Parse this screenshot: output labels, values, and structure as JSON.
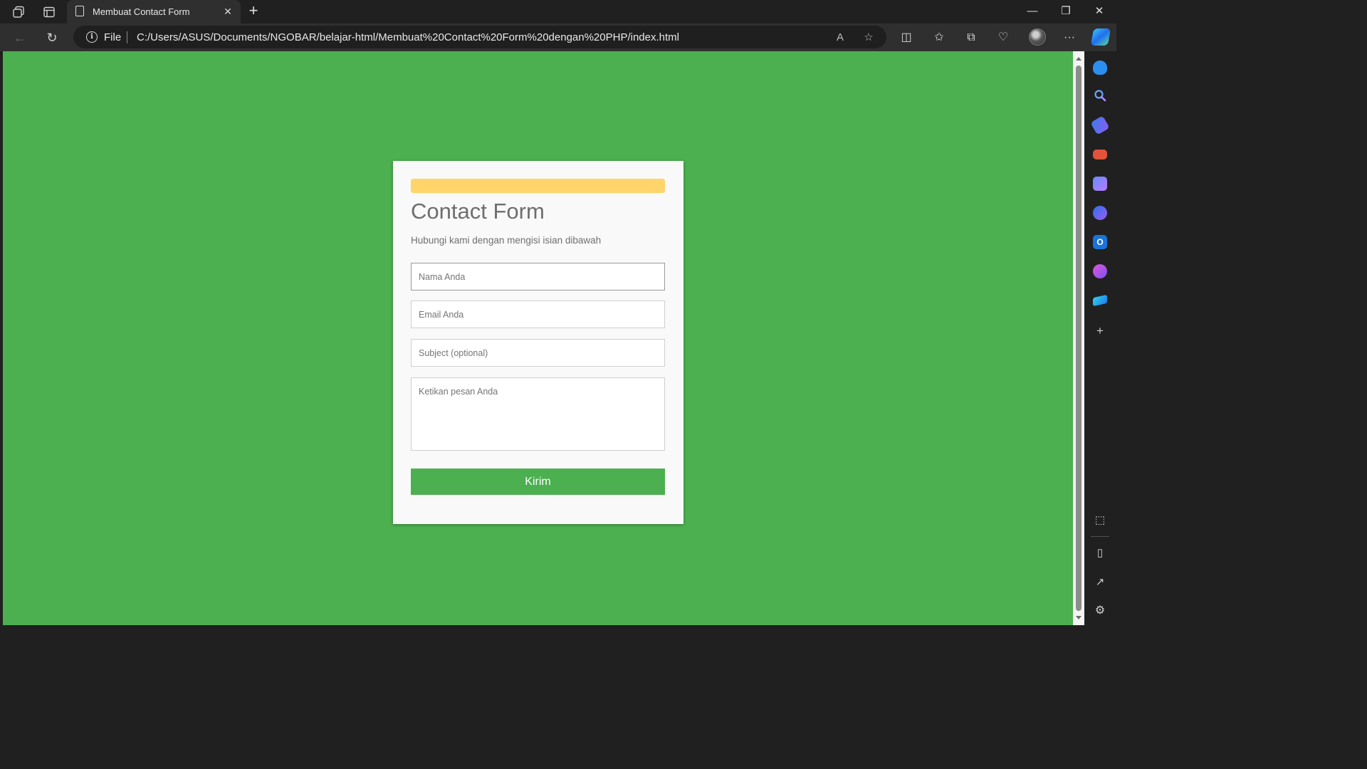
{
  "browser": {
    "tab_title": "Membuat Contact Form",
    "tab_close": "✕",
    "new_tab": "+",
    "window_controls": {
      "minimize": "—",
      "restore": "❐",
      "close": "✕"
    },
    "nav": {
      "back": "←",
      "reload": "↻"
    },
    "address": {
      "site_info": "i",
      "scheme_label": "File",
      "url": "C:/Users/ASUS/Documents/NGOBAR/belajar-html/Membuat%20Contact%20Form%20dengan%20PHP/index.html",
      "read_aloud_icon": "A",
      "favorite_icon": "☆"
    },
    "toolbar_icons": {
      "split": "◫",
      "favorites": "✩",
      "collections": "⧉",
      "performance": "♡",
      "more": "···"
    },
    "sidebar_icons": [
      "bell",
      "search",
      "shopping-tag",
      "tools",
      "games",
      "copilot-circle",
      "outlook",
      "designer",
      "telegram-send"
    ],
    "sidebar_add": "+",
    "sidebar_bottom": {
      "screenshot": "⬚",
      "hide": "▯",
      "external": "↗",
      "settings": "⚙"
    }
  },
  "page": {
    "background": "#4caf50",
    "accent_color": "#ffd56b",
    "heading": "Contact Form",
    "subtitle": "Hubungi kami dengan mengisi isian dibawah",
    "fields": {
      "name_placeholder": "Nama Anda",
      "email_placeholder": "Email Anda",
      "subject_placeholder": "Subject (optional)",
      "message_placeholder": "Ketikan pesan Anda"
    },
    "submit_label": "Kirim"
  }
}
